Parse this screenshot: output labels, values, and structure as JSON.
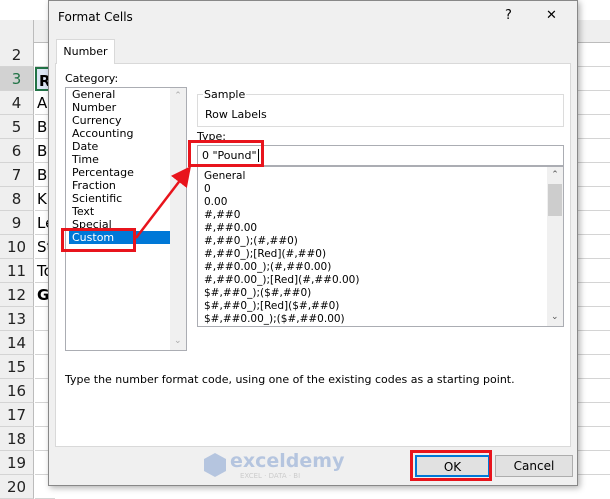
{
  "sheet": {
    "rows": [
      {
        "n": "2",
        "v": ""
      },
      {
        "n": "3",
        "v": "R",
        "bold": true,
        "sel": true
      },
      {
        "n": "4",
        "v": "A"
      },
      {
        "n": "5",
        "v": "B"
      },
      {
        "n": "6",
        "v": "B"
      },
      {
        "n": "7",
        "v": "B"
      },
      {
        "n": "8",
        "v": "Ki"
      },
      {
        "n": "9",
        "v": "Le"
      },
      {
        "n": "10",
        "v": "St"
      },
      {
        "n": "11",
        "v": "To"
      },
      {
        "n": "12",
        "v": "G",
        "bold": true
      },
      {
        "n": "13",
        "v": ""
      },
      {
        "n": "14",
        "v": ""
      },
      {
        "n": "15",
        "v": ""
      },
      {
        "n": "16",
        "v": ""
      },
      {
        "n": "17",
        "v": ""
      },
      {
        "n": "18",
        "v": ""
      },
      {
        "n": "19",
        "v": ""
      },
      {
        "n": "20",
        "v": ""
      }
    ]
  },
  "dialog": {
    "title": "Format Cells",
    "help": "?",
    "close": "✕",
    "tab": "Number",
    "category_label": "Category:",
    "categories": [
      "General",
      "Number",
      "Currency",
      "Accounting",
      "Date",
      "Time",
      "Percentage",
      "Fraction",
      "Scientific",
      "Text",
      "Special",
      "Custom"
    ],
    "selected_category": "Custom",
    "sample_label": "Sample",
    "sample_value": "Row Labels",
    "type_label": "Type:",
    "type_value": "0 \"Pound\"",
    "formats": [
      "General",
      "0",
      "0.00",
      "#,##0",
      "#,##0.00",
      "#,##0_);(#,##0)",
      "#,##0_);[Red](#,##0)",
      "#,##0.00_);(#,##0.00)",
      "#,##0.00_);[Red](#,##0.00)",
      "$#,##0_);($#,##0)",
      "$#,##0_);[Red]($#,##0)",
      "$#,##0.00_);($#,##0.00)"
    ],
    "description": "Type the number format code, using one of the existing codes as a starting point.",
    "ok": "OK",
    "cancel": "Cancel"
  },
  "watermark": {
    "name": "exceldemy",
    "tagline": "EXCEL · DATA · BI"
  },
  "colors": {
    "selection": "#0078d7",
    "annotation": "#e8141c"
  }
}
